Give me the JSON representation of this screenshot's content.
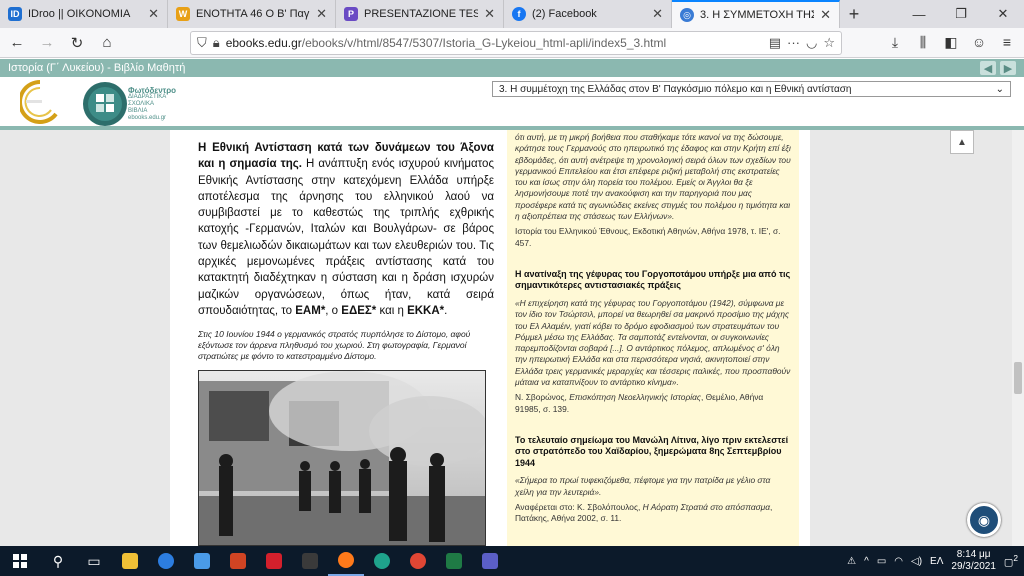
{
  "tabs": [
    {
      "title": "IDroo || OIKONOMIA",
      "color": "#1f6fd1",
      "glyph": "ID"
    },
    {
      "title": "ΕΝΟΤΗΤΑ 46 Ο Β' Παγκόσμιος",
      "color": "#e8a016",
      "glyph": "W"
    },
    {
      "title": "PRESENTAZIONE TESINA2.ppt |",
      "color": "#6a4bc4",
      "glyph": "P"
    },
    {
      "title": "(2) Facebook",
      "color": "#1877f2",
      "glyph": "f"
    },
    {
      "title": "3. Η ΣΥΜΜΕΤΟΧΗ ΤΗΣ ΕΛΛΑΔ",
      "color": "#3a7bd5",
      "glyph": "◎"
    }
  ],
  "browser": {
    "url_prefix": "ebooks.edu.gr",
    "url_rest": "/ebooks/v/html/8547/5307/Istoria_G-Lykeiou_html-apli/index5_3.html"
  },
  "site": {
    "breadcrumb": "Ιστορία (Γ΄ Λυκείου) - Βιβλίο Μαθητή",
    "logo_name": "Φωτόδεντρο",
    "logo_sub": "ΔΙΑΔΡΑΣΤΙΚΑ ΣΧΟΛΙΚΑ ΒΙΒΛΙΑ",
    "logo_url": "ebooks.edu.gr",
    "chapter": "3. Η συμμέτοχη της Ελλάδας στον Β' Παγκόσμιο πόλεμο και η Εθνική αντίσταση"
  },
  "main": {
    "intro_heading": "Η Εθνική Αντίσταση κατά των δυνάμεων του Άξονα και η σημασία της.",
    "intro_text": " Η ανάπτυξη ενός ισχυρού κινήματος Εθνικής Αντίστασης στην κατεχόμενη Ελλάδα υπήρξε αποτέλεσμα της άρνησης του ελληνικού λαού να συμβιβαστεί με το καθεστώς της τριπλής εχθρικής κατοχής -Γερμανών, Ιταλών και Βουλγάρων- σε βάρος των θεμελιωδών δικαιωμάτων και των ελευθεριών του. Τις αρχικές μεμονωμένες πράξεις αντίστασης κατά του κατακτητή διαδέχτηκαν η σύσταση και η δράση ισχυρών μαζικών οργανώσεων, όπως ήταν, κατά σειρά σπουδαιότητας, το ",
    "eam": "ΕΑΜ*",
    "sep1": ", ο ",
    "edes": "ΕΔΕΣ*",
    "sep2": " και η ",
    "ekka": "ΕΚΚΑ*",
    "end": ".",
    "caption": "Στις 10 Ιουνίου 1944 ο γερμανικός στρατός πυρπόλησε το Δίστομο, αφού εξόντωσε τον άρρενα πληθυσμό του χωριού. Στη φωτογραφία, Γερμανοί στρατιώτες με φόντο το κατεστραμμένο Δίστομο."
  },
  "sidebar": {
    "quote1": "ότι αυτή, με τη μικρή βοήθεια που σταθήκαμε τότε ικανοί να της δώσουμε, κράτησε τους Γερμανούς στο ηπειρωτικό της έδαφος και στην Κρήτη επί έξι εβδομάδες, ότι αυτή ανέτρεψε τη χρονολογική σειρά όλων των σχεδίων του γερμανικού Επιτελείου και έτσι επέφερε ριζική μεταβολή στις εκστρατείες του και ίσως στην όλη πορεία του πολέμου. Εμείς οι Άγγλοι θα ξε λησμονήσουμε ποτέ την ανακούφιση και την παρηγοριά που μας προσέφερε κατά τις αγωνιώδεις εκείνες στιγμές του πολέμου η τιμιότητα και η αξιοπρέπεια της στάσεως των Ελλήνων».",
    "source1": "Ιστορία του Ελληνικού Έθνους, Εκδοτική Αθηνών, Αθήνα 1978, τ. ΙΕ', σ. 457.",
    "heading2": "Η ανατίναξη της γέφυρας του Γοργοποτάμου υπήρξε μια από τις σημαντικότερες αντιστασιακές πράξεις",
    "quote2": "«Η επιχείρηση κατά της γέφυρας του Γοργοποτάμου (1942), σύμφωνα με τον ίδιο τον Τσώρτσιλ, μπορεί να θεωρηθεί σα μακρινό προσίμιο της μάχης του Ελ Αλαμέιν, γιατί κόβει το δρόμο εφοδιασμού των στρατευμάτων του Ρόμμελ μέσω της Ελλάδας. Τα σαμποτάζ εντείνονται, οι συγκοινωνίες παρεμποδίζονται σοβαρά [...]. Ο αντάρτικος πόλεμος, απλωμένος σ' όλη την ηπειρωτική Ελλάδα και στα περισσότερα νησιά, ακινητοποιεί στην Ελλάδα τρεις γερμανικές μεραρχίες και τέσσερις ιταλικές, που προσπαθούν μάταια να καταπνίξουν το αντάρτικο κίνημα».",
    "source2_author": "Ν. Σβορώνος, ",
    "source2_title": "Επισκόπηση Νεοελληνικής Ιστορίας",
    "source2_rest": ", Θεμέλιο, Αθήνα 91985, σ. 139.",
    "heading3": "Το τελευταίο σημείωμα του Μανώλη Λίτινα, λίγο πριν εκτελεστεί στο στρατόπεδο του Χαϊδαρίου, ξημερώματα 8ης Σεπτεμβρίου 1944",
    "quote3": "«Σήμερα το πρωί τυφεκιζόμεθα, πέφτομε για την πατρίδα με γέλιο στα χείλη για την λευτεριά».",
    "source3_prefix": "Αναφέρεται στο: Κ. Σβολόπουλος, ",
    "source3_title": "Η Αόρατη Στρατιά στο απόσπασμα",
    "source3_rest": ", Πατάκης, Αθήνα 2002, σ. 11."
  },
  "taskbar": {
    "lang": "ΕΛ",
    "time": "8:14 μμ",
    "date": "29/3/2021",
    "notif_count": "2"
  }
}
